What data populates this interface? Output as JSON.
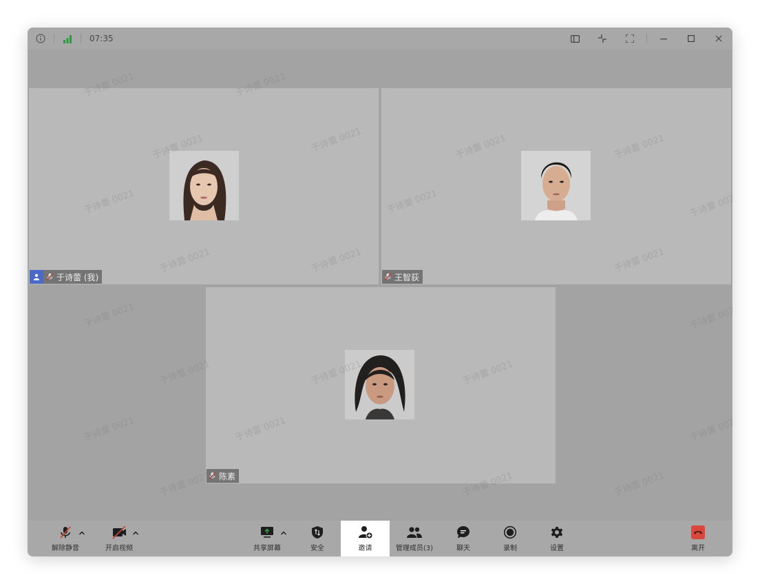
{
  "titlebar": {
    "time": "07:35",
    "icons": [
      "info-icon",
      "signal-icon",
      "sidebar-layout-icon",
      "exit-fullscreen-icon",
      "fullscreen-icon",
      "minimize-icon",
      "maximize-icon",
      "close-icon"
    ]
  },
  "watermark": "于诗蕾 0021",
  "participants": [
    {
      "name": "于诗蕾 (我)",
      "is_me": true,
      "muted": true
    },
    {
      "name": "王智荻",
      "is_me": false,
      "muted": true
    },
    {
      "name": "陈素",
      "is_me": false,
      "muted": true
    }
  ],
  "toolbar": {
    "unmute": "解除静音",
    "start_video": "开启视频",
    "share_screen": "共享屏幕",
    "security": "安全",
    "invite": "邀请",
    "manage_members": "管理成员(3)",
    "chat": "聊天",
    "record": "录制",
    "settings": "设置",
    "leave": "离开"
  },
  "colors": {
    "signal": "#2e9a3e",
    "leave": "#d9463b",
    "me_badge": "#4a69c9",
    "muted_mic": "#c0463c"
  }
}
